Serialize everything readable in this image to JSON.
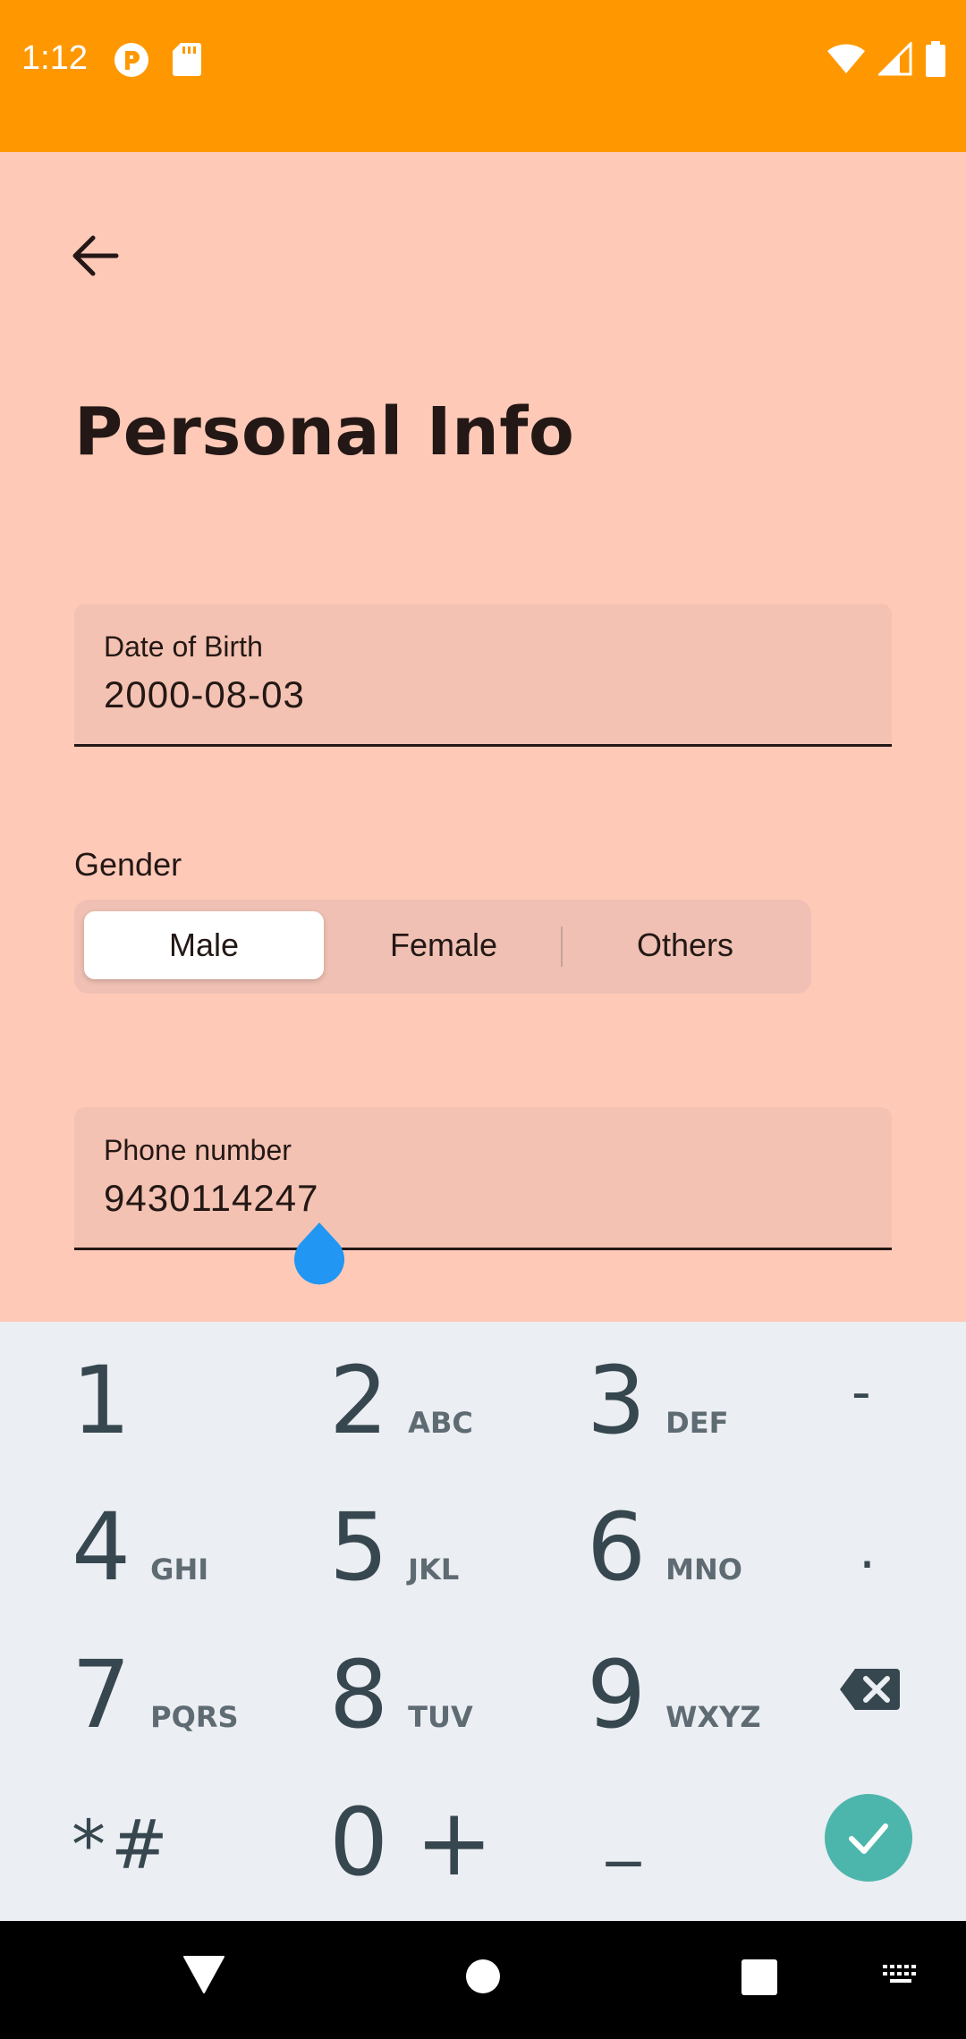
{
  "status_bar": {
    "time": "1:12",
    "left_icons": [
      "app-notification-icon",
      "sd-card-icon"
    ],
    "right_icons": [
      "wifi-icon",
      "cell-signal-icon",
      "battery-icon"
    ]
  },
  "header": {
    "back_icon": "arrow-back-icon",
    "title": "Personal Info"
  },
  "dob_field": {
    "label": "Date of Birth",
    "value": "2000-08-03"
  },
  "gender": {
    "label": "Gender",
    "options": [
      "Male",
      "Female",
      "Others"
    ],
    "selected": "Male"
  },
  "phone_field": {
    "label": "Phone number",
    "value": "9430114247"
  },
  "keyboard": {
    "rows": [
      [
        {
          "digit": "1",
          "letters": ""
        },
        {
          "digit": "2",
          "letters": "ABC"
        },
        {
          "digit": "3",
          "letters": "DEF"
        },
        {
          "symbol": "-"
        }
      ],
      [
        {
          "digit": "4",
          "letters": "GHI"
        },
        {
          "digit": "5",
          "letters": "JKL"
        },
        {
          "digit": "6",
          "letters": "MNO"
        },
        {
          "symbol": "."
        }
      ],
      [
        {
          "digit": "7",
          "letters": "PQRS"
        },
        {
          "digit": "8",
          "letters": "TUV"
        },
        {
          "digit": "9",
          "letters": "WXYZ"
        },
        {
          "symbol": "backspace-icon"
        }
      ],
      [
        {
          "symbol": "*#"
        },
        {
          "digit": "0",
          "letters": "+"
        },
        {
          "symbol": "_"
        },
        {
          "symbol": "check-icon"
        }
      ]
    ]
  },
  "nav_bar": {
    "icons": [
      "back-triangle-icon",
      "home-circle-icon",
      "recents-square-icon",
      "keyboard-switch-icon"
    ]
  },
  "colors": {
    "status_bar": "#FF9800",
    "background": "#FFC9B8",
    "field_bg": "#F4C2B2",
    "accent": "#4DB6AC",
    "cursor": "#2196F3"
  }
}
